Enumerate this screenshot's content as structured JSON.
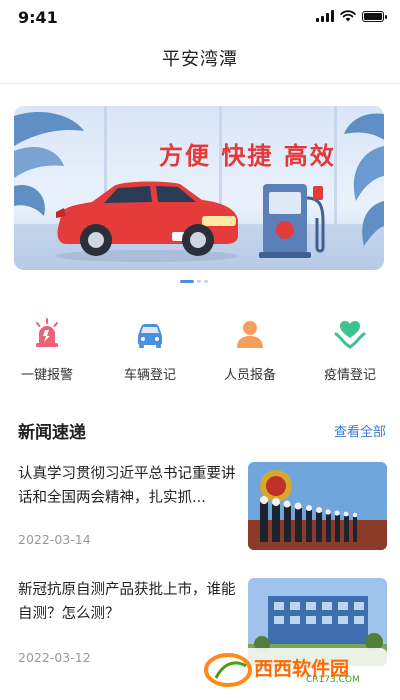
{
  "status_bar": {
    "time": "9:41"
  },
  "nav": {
    "title": "平安湾潭"
  },
  "banner": {
    "slogan": "方便 快捷 高效"
  },
  "quick_actions": [
    {
      "label": "一键报警",
      "icon": "siren-icon",
      "color": "#f0607a"
    },
    {
      "label": "车辆登记",
      "icon": "car-icon",
      "color": "#4a8fe0"
    },
    {
      "label": "人员报备",
      "icon": "person-icon",
      "color": "#f5a05a"
    },
    {
      "label": "疫情登记",
      "icon": "heart-hands-icon",
      "color": "#3ec28f"
    }
  ],
  "news": {
    "title": "新闻速递",
    "view_all": "查看全部",
    "items": [
      {
        "title": "认真学习贯彻习近平总书记重要讲话和全国两会精神，扎实抓...",
        "date": "2022-03-14"
      },
      {
        "title": "新冠抗原自测产品获批上市，谁能自测？怎么测？",
        "date": "2022-03-12"
      }
    ]
  },
  "watermark": {
    "brand": "西西软件园",
    "domain": "CR173.COM"
  }
}
